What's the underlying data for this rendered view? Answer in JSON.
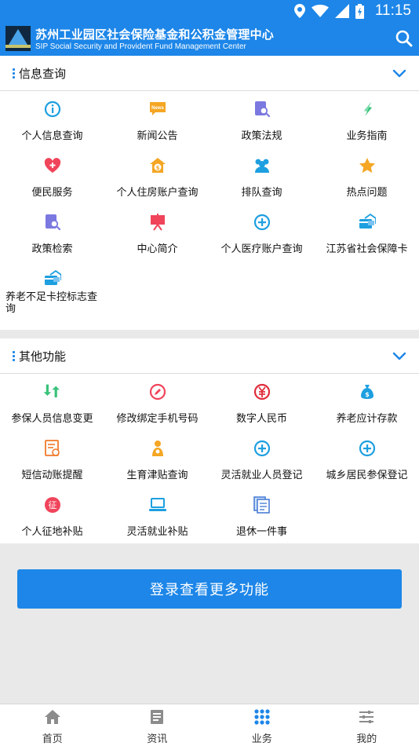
{
  "status_bar": {
    "time": "11:15"
  },
  "header": {
    "title": "苏州工业园区社会保险基金和公积金管理中心",
    "subtitle": "SIP Social Security and Provident Fund Management Center"
  },
  "sections": [
    {
      "title": "信息查询",
      "items": [
        {
          "label": "个人信息查询",
          "icon": "info-icon",
          "color": "#1d9fe0"
        },
        {
          "label": "新闻公告",
          "icon": "news-icon",
          "color": "#f5a623"
        },
        {
          "label": "政策法规",
          "icon": "search-doc-icon",
          "color": "#7b78e0"
        },
        {
          "label": "业务指南",
          "icon": "compass-icon",
          "color": "#3ac27a"
        },
        {
          "label": "便民服务",
          "icon": "heart-icon",
          "color": "#f0445b"
        },
        {
          "label": "个人住房账户查询",
          "icon": "house-coin-icon",
          "color": "#f5a623"
        },
        {
          "label": "排队查询",
          "icon": "people-icon",
          "color": "#1d9fe0"
        },
        {
          "label": "热点问题",
          "icon": "star-icon",
          "color": "#f5a623"
        },
        {
          "label": "政策检索",
          "icon": "search-doc-icon",
          "color": "#7b78e0"
        },
        {
          "label": "中心简介",
          "icon": "easel-icon",
          "color": "#f0445b"
        },
        {
          "label": "个人医疗账户查询",
          "icon": "plus-circle-icon",
          "color": "#1d9fe0"
        },
        {
          "label": "江苏省社会保障卡",
          "icon": "card-icon",
          "color": "#1d9fe0"
        },
        {
          "label": "养老不足卡控标志查询",
          "icon": "card-icon",
          "color": "#1d9fe0"
        }
      ]
    },
    {
      "title": "其他功能",
      "items": [
        {
          "label": "参保人员信息变更",
          "icon": "swap-arrows-icon",
          "color": "#3ac27a"
        },
        {
          "label": "修改绑定手机号码",
          "icon": "edit-circle-icon",
          "color": "#f0445b"
        },
        {
          "label": "数字人民币",
          "icon": "yuan-icon",
          "color": "#e02d3c"
        },
        {
          "label": "养老应计存款",
          "icon": "money-bag-icon",
          "color": "#1d9fe0"
        },
        {
          "label": "短信动账提醒",
          "icon": "message-doc-icon",
          "color": "#f07a2a"
        },
        {
          "label": "生育津贴查询",
          "icon": "baby-icon",
          "color": "#f5a623"
        },
        {
          "label": "灵活就业人员登记",
          "icon": "plus-circle-icon",
          "color": "#1d9fe0"
        },
        {
          "label": "城乡居民参保登记",
          "icon": "plus-circle-icon",
          "color": "#1d9fe0"
        },
        {
          "label": "个人征地补贴",
          "icon": "zheng-badge-icon",
          "color": "#f0445b",
          "glyph": "征"
        },
        {
          "label": "灵活就业补贴",
          "icon": "laptop-icon",
          "color": "#1d9fe0"
        },
        {
          "label": "退休一件事",
          "icon": "documents-icon",
          "color": "#4a7fd6"
        }
      ]
    }
  ],
  "login_button": {
    "label": "登录查看更多功能"
  },
  "bottom_nav": [
    {
      "label": "首页",
      "icon": "home-icon"
    },
    {
      "label": "资讯",
      "icon": "news-list-icon"
    },
    {
      "label": "业务",
      "icon": "grid-dots-icon",
      "active": true
    },
    {
      "label": "我的",
      "icon": "sliders-icon"
    }
  ],
  "colors": {
    "primary": "#1d86e8",
    "background": "#e9e9e9"
  }
}
